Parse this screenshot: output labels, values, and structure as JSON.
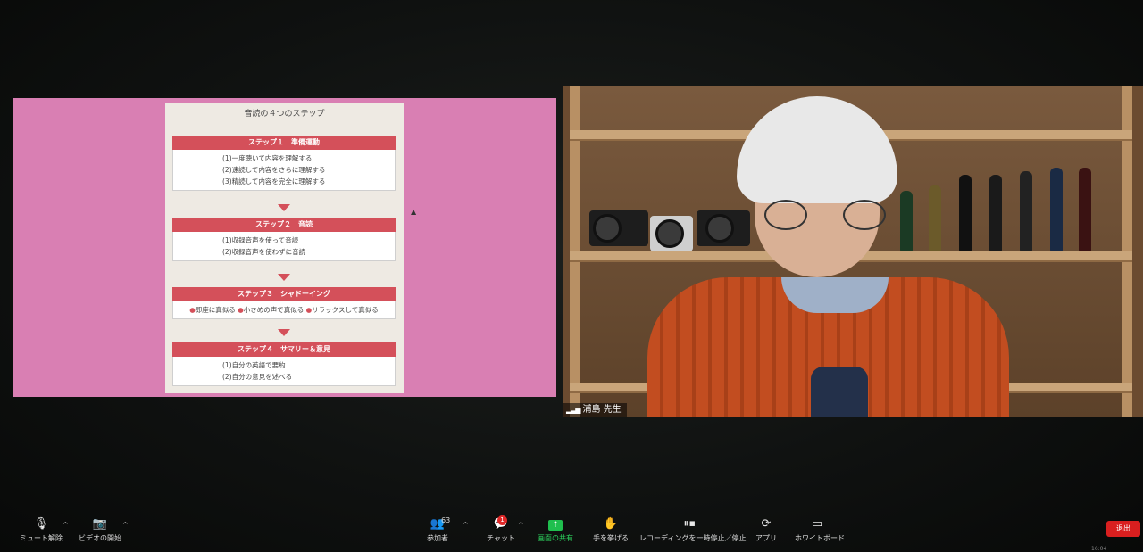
{
  "slide": {
    "title": "音読の４つのステップ",
    "steps": [
      {
        "heading": "ステップ１　準備運動",
        "lines": [
          "(1)一度聴いて内容を理解する",
          "(2)速読して内容をさらに理解する",
          "(3)精読して内容を完全に理解する"
        ]
      },
      {
        "heading": "ステップ２　音読",
        "lines": [
          "(1)収録音声を使って音読",
          "(2)収録音声を使わずに音読"
        ]
      },
      {
        "heading": "ステップ３　シャドーイング",
        "items": [
          "即座に真似る",
          "小さめの声で真似る",
          "リラックスして真似る"
        ]
      },
      {
        "heading": "ステップ４　サマリー＆意見",
        "lines": [
          "(1)自分の英語で要約",
          "(2)自分の意見を述べる"
        ]
      }
    ]
  },
  "video": {
    "participant_name": "浦島 先生"
  },
  "toolbar": {
    "mute_label": "ミュート解除",
    "video_label": "ビデオの開始",
    "participants_label": "参加者",
    "participants_count": "63",
    "chat_label": "チャット",
    "chat_badge": "1",
    "share_label": "画面の共有",
    "raise_hand_label": "手を挙げる",
    "recording_label": "レコーディングを一時停止／停止",
    "apps_label": "アプリ",
    "whiteboard_label": "ホワイトボード",
    "leave_label": "退出",
    "clock": "16:04"
  },
  "colors": {
    "slide_bg": "#d97fb3",
    "step_header": "#d4505a",
    "share_green": "#1fbf4e",
    "leave_red": "#d91f1f"
  }
}
